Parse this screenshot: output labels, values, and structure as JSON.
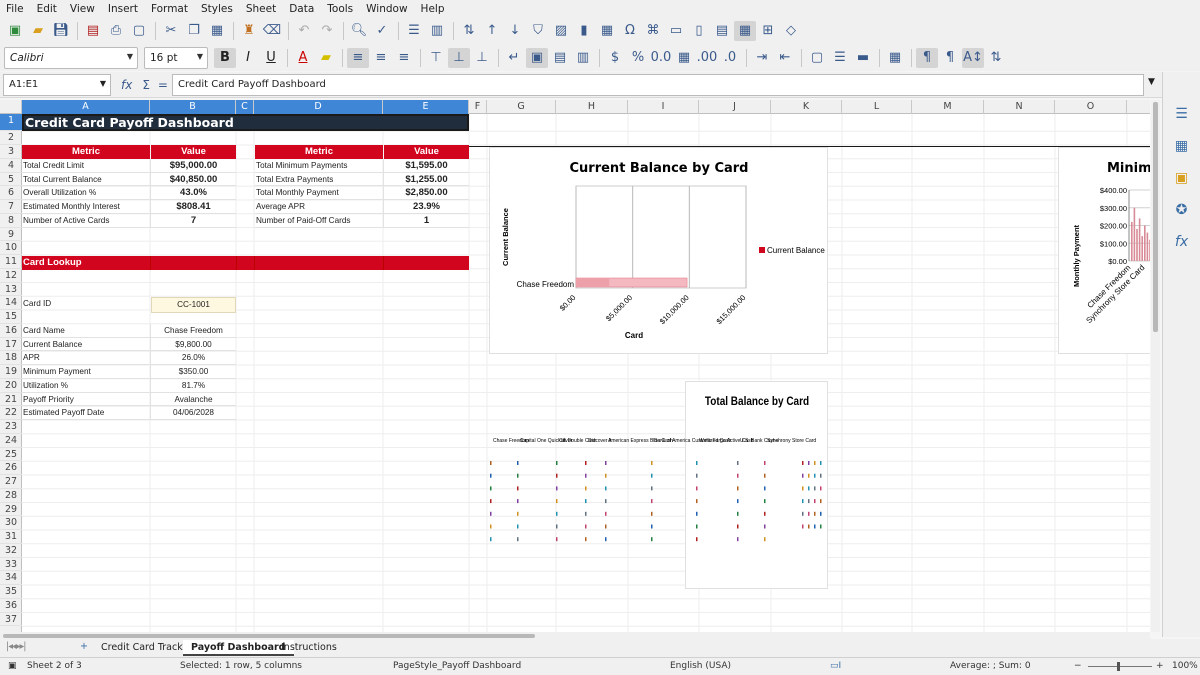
{
  "menu": [
    "File",
    "Edit",
    "View",
    "Insert",
    "Format",
    "Styles",
    "Sheet",
    "Data",
    "Tools",
    "Window",
    "Help"
  ],
  "font": {
    "name": "Calibri",
    "size": "16 pt"
  },
  "formula_bar": {
    "name_box": "A1:E1",
    "content": "Credit Card Payoff Dashboard"
  },
  "columns": [
    "A",
    "B",
    "C",
    "D",
    "E",
    "F",
    "G",
    "H",
    "I",
    "J",
    "K",
    "L",
    "M",
    "N",
    "O"
  ],
  "rows": [
    "1",
    "2",
    "3",
    "4",
    "5",
    "6",
    "7",
    "8",
    "9",
    "10",
    "11",
    "12",
    "13",
    "14",
    "15",
    "16",
    "17",
    "18",
    "19",
    "20",
    "21",
    "22",
    "23",
    "24",
    "25",
    "26",
    "27",
    "28",
    "29",
    "30",
    "31",
    "32",
    "33",
    "34",
    "35",
    "36",
    "37"
  ],
  "sheet": {
    "title": "Credit Card Payoff Dashboard",
    "left_table": {
      "headers": [
        "Metric",
        "Value"
      ],
      "rows": [
        [
          "Total Credit Limit",
          "$95,000.00"
        ],
        [
          "Total Current Balance",
          "$40,850.00"
        ],
        [
          "Overall Utilization %",
          "43.0%"
        ],
        [
          "Estimated Monthly Interest",
          "$808.41"
        ],
        [
          "Number of Active Cards",
          "7"
        ]
      ]
    },
    "right_table": {
      "headers": [
        "Metric",
        "Value"
      ],
      "rows": [
        [
          "Total Minimum Payments",
          "$1,595.00"
        ],
        [
          "Total Extra Payments",
          "$1,255.00"
        ],
        [
          "Total Monthly Payment",
          "$2,850.00"
        ],
        [
          "Average APR",
          "23.9%"
        ],
        [
          "Number of Paid-Off Cards",
          "1"
        ]
      ]
    },
    "card_lookup": {
      "header": "Card Lookup",
      "card_id_label": "Card ID",
      "card_id_value": "CC-1001",
      "rows": [
        [
          "Card Name",
          "Chase Freedom"
        ],
        [
          "Current Balance",
          "$9,800.00"
        ],
        [
          "APR",
          "26.0%"
        ],
        [
          "Minimum Payment",
          "$350.00"
        ],
        [
          "Utilization %",
          "81.7%"
        ],
        [
          "Payoff Priority",
          "Avalanche"
        ],
        [
          "Estimated Payoff Date",
          "04/06/2028"
        ]
      ]
    }
  },
  "chart_data": [
    {
      "type": "bar",
      "title": "Current Balance by Card",
      "xlabel": "Card",
      "ylabel": "Current Balance",
      "categories": [
        "Chase Freedom"
      ],
      "series": [
        {
          "name": "Current Balance",
          "values": [
            9800
          ]
        }
      ],
      "x_ticks": [
        "$0.00",
        "$5,000.00",
        "$10,000.00",
        "$15,000.00"
      ],
      "xlim": [
        0,
        15000
      ],
      "legend": "right",
      "color": "#d2051e"
    },
    {
      "type": "bar",
      "title": "Minimu",
      "ylabel": "Monthly Payment",
      "y_ticks": [
        "$400.00",
        "$300.00",
        "$200.00",
        "$100.00",
        "$0.00"
      ],
      "ylim": [
        0,
        400
      ],
      "categories": [
        "Chase Freedom",
        "Synchrony Store Card"
      ],
      "color": "#d2051e"
    },
    {
      "type": "table",
      "title": "Total Balance by Card",
      "categories": [
        "Chase Freedom",
        "Capital One Quicksilver",
        "Citi Double Cash",
        "Discover it",
        "American Express Blue Cash",
        "Bank of America Customized Cash",
        "Wells Fargo Active Cash",
        "U.S. Bank Cash+",
        "Synchrony Store Card"
      ]
    }
  ],
  "tabs": [
    "Credit Card Tracker",
    "Payoff Dashboard",
    "Instructions"
  ],
  "status": {
    "sheet": "Sheet 2 of 3",
    "selection": "Selected: 1 row, 5 columns",
    "page_style": "PageStyle_Payoff Dashboard",
    "language": "English (USA)",
    "summary": "Average: ; Sum: 0",
    "zoom": "100%"
  }
}
